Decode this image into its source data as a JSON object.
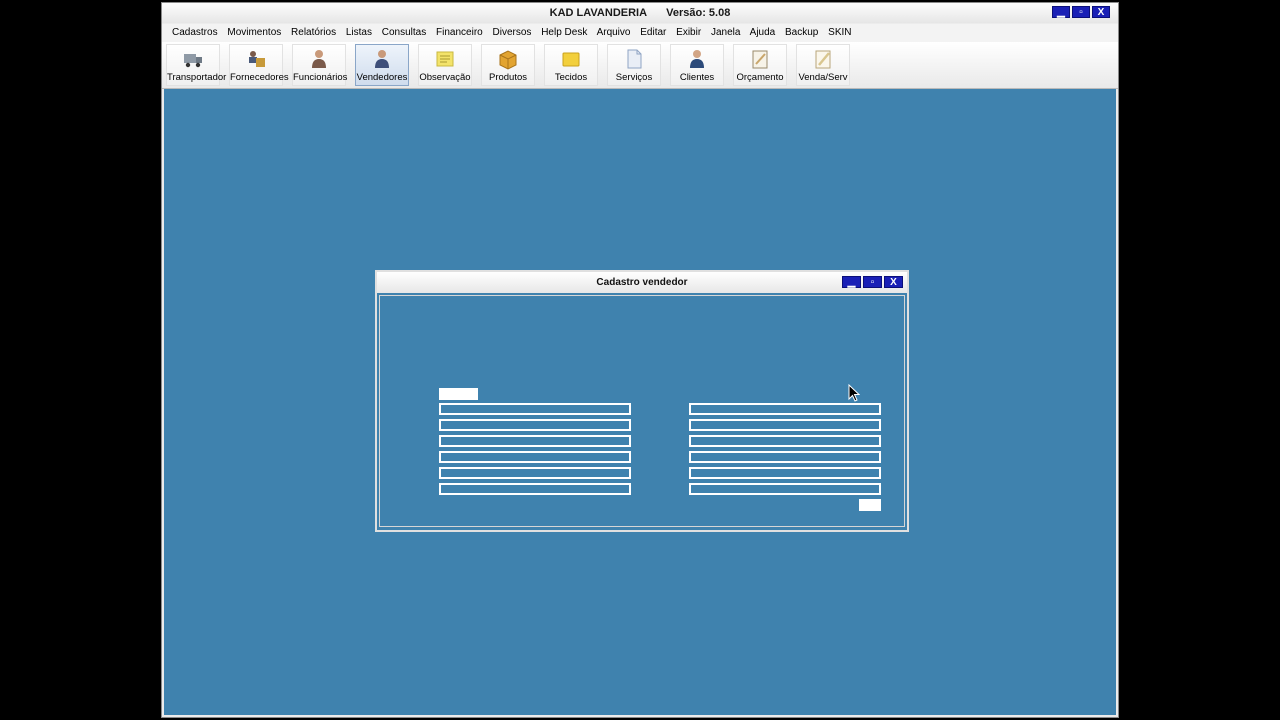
{
  "window": {
    "title": "KAD LAVANDERIA",
    "version": "Versão: 5.08",
    "controls": {
      "minimize": "▁",
      "maximize": "▫",
      "close": "X"
    }
  },
  "menu": [
    "Cadastros",
    "Movimentos",
    "Relatórios",
    "Listas",
    "Consultas",
    "Financeiro",
    "Diversos",
    "Help Desk",
    "Arquivo",
    "Editar",
    "Exibir",
    "Janela",
    "Ajuda",
    "Backup",
    "SKIN"
  ],
  "toolbar": [
    {
      "label": "Transportador",
      "icon": "truck-icon",
      "color": "#8f9aa6",
      "active": false
    },
    {
      "label": "Fornecedores",
      "icon": "suppliers-icon",
      "color": "#c79a3a",
      "active": false
    },
    {
      "label": "Funcionários",
      "icon": "employee-icon",
      "color": "#7a5a4a",
      "active": false
    },
    {
      "label": "Vendedores",
      "icon": "salesman-icon",
      "color": "#3e4f7a",
      "active": true
    },
    {
      "label": "Observação",
      "icon": "note-icon",
      "color": "#e8d84a",
      "active": false
    },
    {
      "label": "Produtos",
      "icon": "box-icon",
      "color": "#e2a431",
      "active": false
    },
    {
      "label": "Tecidos",
      "icon": "fabric-icon",
      "color": "#f2cf3c",
      "active": false
    },
    {
      "label": "Serviços",
      "icon": "document-icon",
      "color": "#9cb6d6",
      "active": false
    },
    {
      "label": "Clientes",
      "icon": "client-icon",
      "color": "#2c4a7a",
      "active": false
    },
    {
      "label": "Orçamento",
      "icon": "budget-icon",
      "color": "#c9a66b",
      "active": false
    },
    {
      "label": "Venda/Serv",
      "icon": "sale-icon",
      "color": "#d9c68f",
      "active": false
    }
  ],
  "dialog": {
    "title": "Cadastro vendedor",
    "controls": {
      "minimize": "▁",
      "maximize": "▫",
      "close": "X"
    }
  },
  "colors": {
    "desktop": "#3f82ae",
    "title_buttons": "#1a20b6"
  }
}
